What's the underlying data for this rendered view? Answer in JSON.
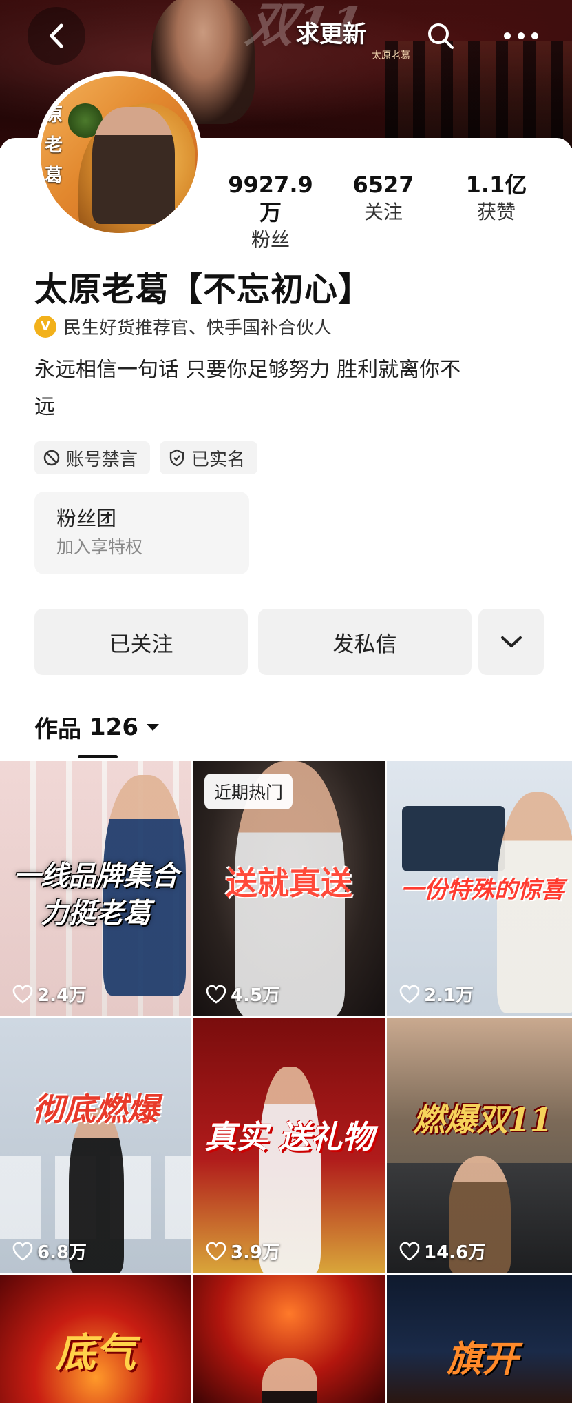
{
  "banner": {
    "title": "求更新",
    "subtitle": "太原老葛",
    "art_text": "双11"
  },
  "avatar": {
    "text": "原老葛"
  },
  "stats": [
    {
      "value": "9927.9万",
      "label": "粉丝"
    },
    {
      "value": "6527",
      "label": "关注"
    },
    {
      "value": "1.1亿",
      "label": "获赞"
    }
  ],
  "profile": {
    "name": "太原老葛【不忘初心】",
    "verified_text": "民生好货推荐官、快手国补合伙人",
    "bio_line1": "永远相信一句话 只要你足够努力 胜利就离你不",
    "bio_line2": "远"
  },
  "tags": {
    "muted": "账号禁言",
    "verified": "已实名"
  },
  "fan_club": {
    "title": "粉丝团",
    "subtitle": "加入享特权"
  },
  "actions": {
    "follow_label": "已关注",
    "message_label": "发私信"
  },
  "works": {
    "label": "作品",
    "count": "126"
  },
  "grid": [
    {
      "title": "一线品牌集合 力挺老葛",
      "likes": "2.4万",
      "badge": ""
    },
    {
      "title": "送就真送",
      "likes": "4.5万",
      "badge": "近期热门"
    },
    {
      "title": "一份特殊的惊喜",
      "likes": "2.1万",
      "badge": ""
    },
    {
      "title": "彻底燃爆",
      "likes": "6.8万",
      "badge": ""
    },
    {
      "title": "真实 送礼物",
      "likes": "3.9万",
      "badge": ""
    },
    {
      "title": "燃爆双11",
      "likes": "14.6万",
      "badge": ""
    },
    {
      "title": "底气",
      "likes": "",
      "badge": ""
    },
    {
      "title": "",
      "likes": "",
      "badge": ""
    },
    {
      "title": "旗开",
      "likes": "",
      "badge": ""
    }
  ],
  "colors": {
    "accent_gold": "#f2b11b",
    "button_bg": "#f1f1f1"
  },
  "icons": [
    "back-arrow-icon",
    "search-icon",
    "more-icon",
    "verified-icon",
    "ban-icon",
    "shield-icon",
    "chevron-down-icon",
    "caret-down-icon",
    "heart-icon"
  ]
}
